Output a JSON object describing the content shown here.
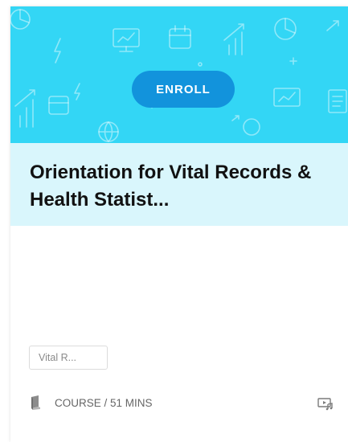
{
  "card": {
    "enroll_label": "ENROLL",
    "title": "Orientation for Vital Records & Health Statist...",
    "tag_label": "Vital R...",
    "meta": "COURSE / 51 MINS",
    "type_icon": "book-icon",
    "media_icon": "media-player-icon"
  },
  "colors": {
    "hero_background": "#33d6f5",
    "title_band": "#d9f6fc",
    "enroll_button": "#1293dc",
    "text_dark": "#111111",
    "text_muted": "#666666"
  }
}
